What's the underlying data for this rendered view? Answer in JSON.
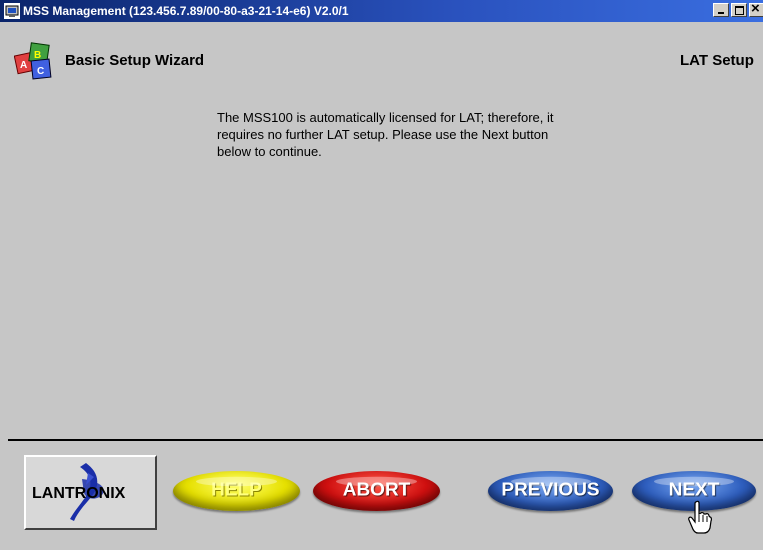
{
  "window": {
    "title": "MSS Management (123.456.7.89/00-80-a3-21-14-e6) V2.0/1"
  },
  "wizard": {
    "title": "Basic Setup Wizard",
    "section": "LAT Setup",
    "message": "The MSS100 is automatically licensed for LAT; therefore, it requires no further LAT setup. Please use the Next button below to continue."
  },
  "logo": {
    "text": "LANTRONIX"
  },
  "buttons": {
    "help": "HELP",
    "abort": "ABORT",
    "previous": "PREVIOUS",
    "next": "NEXT"
  },
  "colors": {
    "titlebar": "#0a246a",
    "help": "#e6e000",
    "abort": "#d01010",
    "nav": "#2f5fbf"
  }
}
